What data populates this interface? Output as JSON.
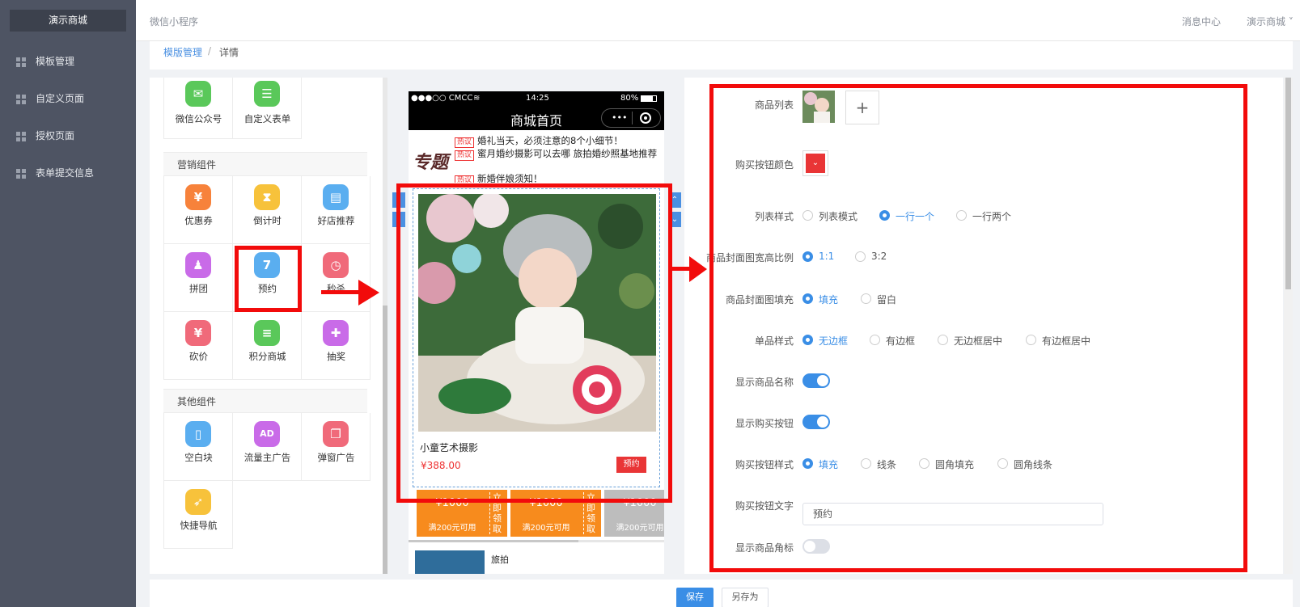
{
  "sidebar": {
    "brand": "演示商城",
    "items": [
      {
        "label": "模板管理"
      },
      {
        "label": "自定义页面"
      },
      {
        "label": "授权页面"
      },
      {
        "label": "表单提交信息"
      }
    ]
  },
  "header": {
    "title": "微信小程序",
    "message_center": "消息中心",
    "user": "演示商城 ˅"
  },
  "breadcrumb": {
    "parent": "模版管理",
    "separator": "/",
    "current": "详情"
  },
  "components": {
    "top_row": [
      {
        "label": "微信公众号",
        "icon": "wechat-icon",
        "color": "#5ac85a",
        "glyph": "✉"
      },
      {
        "label": "自定义表单",
        "icon": "form-icon",
        "color": "#5ac85a",
        "glyph": "☰"
      }
    ],
    "marketing_title": "营销组件",
    "marketing": [
      {
        "label": "优惠券",
        "icon": "coupon-icon",
        "color": "#f7823b",
        "glyph": "¥"
      },
      {
        "label": "倒计时",
        "icon": "hourglass-icon",
        "color": "#f7c23b",
        "glyph": "⧗"
      },
      {
        "label": "好店推荐",
        "icon": "shop-icon",
        "color": "#5aaef0",
        "glyph": "▤"
      },
      {
        "label": "拼团",
        "icon": "group-icon",
        "color": "#c96be8",
        "glyph": "♟"
      },
      {
        "label": "预约",
        "icon": "calendar-icon",
        "color": "#5aaef0",
        "glyph": "7"
      },
      {
        "label": "秒杀",
        "icon": "alarm-icon",
        "color": "#f06a7a",
        "glyph": "◷"
      },
      {
        "label": "砍价",
        "icon": "yuan-icon",
        "color": "#f06a7a",
        "glyph": "¥"
      },
      {
        "label": "积分商城",
        "icon": "coins-icon",
        "color": "#5ac85a",
        "glyph": "≡"
      },
      {
        "label": "抽奖",
        "icon": "gift-icon",
        "color": "#c96be8",
        "glyph": "✚"
      }
    ],
    "other_title": "其他组件",
    "other": [
      {
        "label": "空白块",
        "icon": "blank-page-icon",
        "color": "#5aaef0",
        "glyph": "▯"
      },
      {
        "label": "流量主广告",
        "icon": "ad-icon",
        "color": "#c96be8",
        "glyph": "AD"
      },
      {
        "label": "弹窗广告",
        "icon": "popup-icon",
        "color": "#f06a7a",
        "glyph": "❐"
      },
      {
        "label": "快捷导航",
        "icon": "compass-icon",
        "color": "#f7c23b",
        "glyph": "➶"
      }
    ]
  },
  "phone": {
    "carrier": "●●●○○ CMCC",
    "time": "14:25",
    "battery": "80%",
    "page_title": "商城首页",
    "capsule_dots": "•••",
    "news_logo": "专题",
    "news_tag": "热议",
    "news": [
      "婚礼当天，必须注意的8个小细节！",
      "蜜月婚纱摄影可以去哪 旅拍婚纱照基地推荐",
      "新婚伴娘须知！"
    ],
    "product": {
      "name": "小童艺术摄影",
      "price": "¥388.00",
      "button": "预约"
    },
    "coupons": [
      {
        "amount": "¥1000",
        "condition": "满200元可用",
        "action": "立即领取"
      },
      {
        "amount": "¥1000",
        "condition": "满200元可用",
        "action": "立即领取"
      },
      {
        "amount": "¥1000",
        "condition": "满200元可用",
        "action": ""
      }
    ],
    "bottom_text": "旅拍"
  },
  "props": {
    "goods_list_label": "商品列表",
    "add_symbol": "+",
    "buy_color_label": "购买按钮颜色",
    "buy_color": "#e93536",
    "list_style_label": "列表样式",
    "list_style_options": [
      "列表模式",
      "一行一个",
      "一行两个"
    ],
    "cover_ratio_label": "商品封面图宽高比例",
    "cover_ratio_options": [
      "1:1",
      "3:2"
    ],
    "cover_fill_label": "商品封面图填充",
    "cover_fill_options": [
      "填充",
      "留白"
    ],
    "item_style_label": "单品样式",
    "item_style_options": [
      "无边框",
      "有边框",
      "无边框居中",
      "有边框居中"
    ],
    "show_name_label": "显示商品名称",
    "show_name": true,
    "show_buy_label": "显示购买按钮",
    "show_buy": true,
    "buy_style_label": "购买按钮样式",
    "buy_style_options": [
      "填充",
      "线条",
      "圆角填充",
      "圆角线条"
    ],
    "buy_text_label": "购买按钮文字",
    "buy_text_value": "预约",
    "show_badge_label": "显示商品角标",
    "show_badge": false
  },
  "footer": {
    "save": "保存",
    "save_as": "另存为"
  }
}
